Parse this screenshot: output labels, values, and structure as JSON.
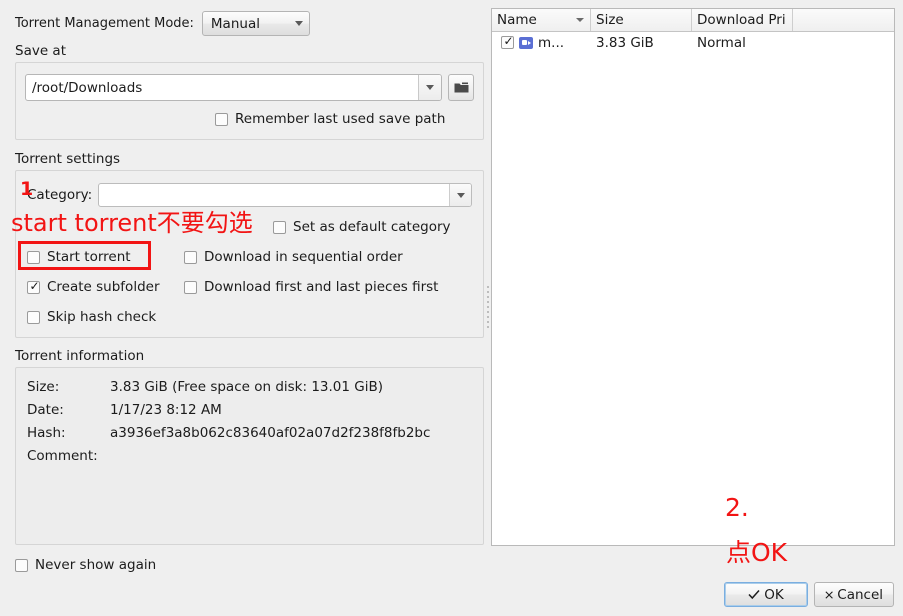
{
  "left": {
    "tmm_label": "Torrent Management Mode:",
    "tmm_value": "Manual",
    "save_at": {
      "title": "Save at",
      "path_value": "/root/Downloads",
      "remember_label": "Remember last used save path",
      "folder_icon": "folder-icon"
    },
    "torrent_settings": {
      "title": "Torrent settings",
      "category_label": "Category:",
      "category_value": "",
      "set_default_label": "Set as default category",
      "start_torrent_label": "Start torrent",
      "sequential_label": "Download in sequential order",
      "create_subfolder_label": "Create subfolder",
      "first_last_label": "Download first and last pieces first",
      "skip_hash_label": "Skip hash check"
    },
    "torrent_information": {
      "title": "Torrent information",
      "size_label": "Size:",
      "size_value": "3.83 GiB (Free space on disk: 13.01 GiB)",
      "date_label": "Date:",
      "date_value": "1/17/23 8:12 AM",
      "hash_label": "Hash:",
      "hash_value": "a3936ef3a8b062c83640af02a07d2f238f8fb2bc",
      "comment_label": "Comment:",
      "comment_value": ""
    },
    "never_show_label": "Never show again"
  },
  "file_list": {
    "columns": [
      "Name",
      "Size",
      "Download Pri"
    ],
    "sorted_column": "Name",
    "rows": [
      {
        "checked": true,
        "icon": "video-file-icon",
        "name": "m...",
        "size": "3.83 GiB",
        "priority": "Normal"
      }
    ]
  },
  "buttons": {
    "ok_label": "OK",
    "ok_icon": "check-icon",
    "cancel_label": "Cancel",
    "cancel_icon": "cross-icon"
  },
  "annotations": {
    "color": "#f21414",
    "step_one": "1",
    "note_one": "start torrent不要勾选",
    "step_two": "2.",
    "note_two": "点OK"
  }
}
